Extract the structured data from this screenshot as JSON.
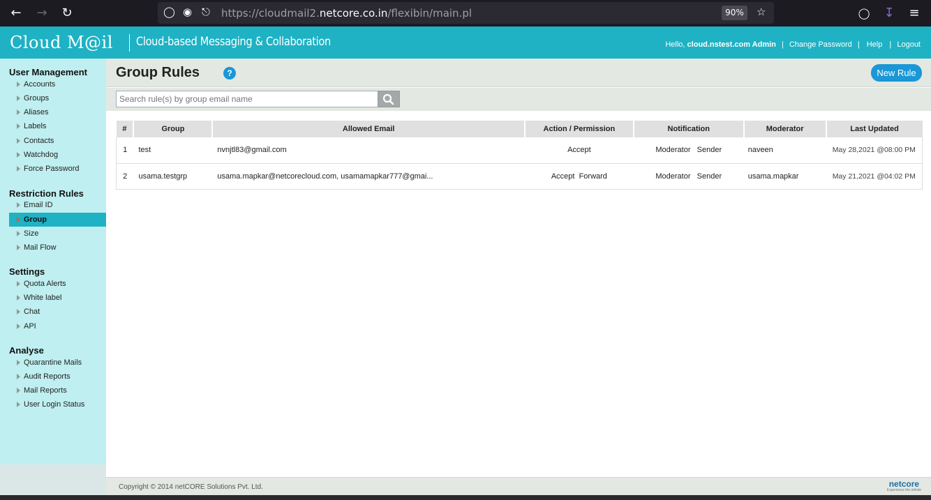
{
  "browser": {
    "url_prefix": "https://cloudmail2.",
    "url_host": "netcore.co.in",
    "url_path": "/flexibin/main.pl",
    "zoom": "90%"
  },
  "header": {
    "logo": "Cloud M@il",
    "tagline": "Cloud-based Messaging & Collaboration",
    "hello": "Hello,",
    "user": "cloud.nstest.com Admin",
    "change_password": "Change Password",
    "help": "Help",
    "logout": "Logout",
    "sep": "|"
  },
  "sidebar": {
    "sections": [
      {
        "title": "User Management",
        "items": [
          "Accounts",
          "Groups",
          "Aliases",
          "Labels",
          "Contacts",
          "Watchdog",
          "Force Password"
        ]
      },
      {
        "title": "Restriction Rules",
        "items": [
          "Email ID",
          "Group",
          "Size",
          "Mail Flow"
        ]
      },
      {
        "title": "Settings",
        "items": [
          "Quota Alerts",
          "White label",
          "Chat",
          "API"
        ]
      },
      {
        "title": "Analyse",
        "items": [
          "Quarantine Mails",
          "Audit Reports",
          "Mail Reports",
          "User Login Status"
        ]
      }
    ],
    "active_item": "Group"
  },
  "main": {
    "title": "Group Rules",
    "help_icon": "?",
    "new_rule_label": "New Rule",
    "search_placeholder": "Search rule(s) by group email name"
  },
  "table": {
    "headers": [
      "#",
      "Group",
      "Allowed Email",
      "Action / Permission",
      "Notification",
      "Moderator",
      "Last Updated"
    ],
    "rows": [
      {
        "num": "1",
        "group": "test",
        "allowed_email": "nvnjtl83@gmail.com",
        "action": "Accept",
        "notification": "Moderator   Sender",
        "moderator": "naveen",
        "last_updated": "May 28,2021 @08:00 PM"
      },
      {
        "num": "2",
        "group": "usama.testgrp",
        "allowed_email": "usama.mapkar@netcorecloud.com, usamamapkar777@gmai...",
        "action": "Accept  Forward",
        "notification": "Moderator   Sender",
        "moderator": "usama.mapkar",
        "last_updated": "May 21,2021 @04:02 PM"
      }
    ]
  },
  "footer": {
    "copyright": "Copyright © 2014 netCORE Solutions Pvt. Ltd.",
    "brand": "netcore",
    "brand_tagline": "Experience the infinite"
  },
  "colors": {
    "header": "#1eb2c4",
    "sidebar": "#bfeff0",
    "accent_button": "#1a97d6",
    "active_arrow": "#e1582a"
  }
}
